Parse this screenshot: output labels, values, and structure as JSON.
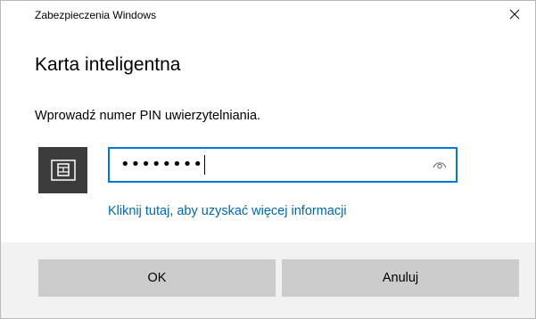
{
  "window": {
    "title": "Zabezpieczenia Windows"
  },
  "dialog": {
    "heading": "Karta inteligentna",
    "prompt": "Wprowadź numer PIN uwierzytelniania.",
    "pin_masked": "••••••••",
    "more_info_link": "Kliknij tutaj, aby uzyskać więcej informacji"
  },
  "buttons": {
    "ok_label": "OK",
    "cancel_label": "Anuluj"
  },
  "icons": {
    "close": "close-icon",
    "smart_card": "smart-card-icon",
    "reveal": "eye-icon"
  },
  "colors": {
    "accent": "#0078d7",
    "link": "#0066b4",
    "tile": "#3c3c3c",
    "button": "#cccccc",
    "footer": "#f2f2f2"
  }
}
